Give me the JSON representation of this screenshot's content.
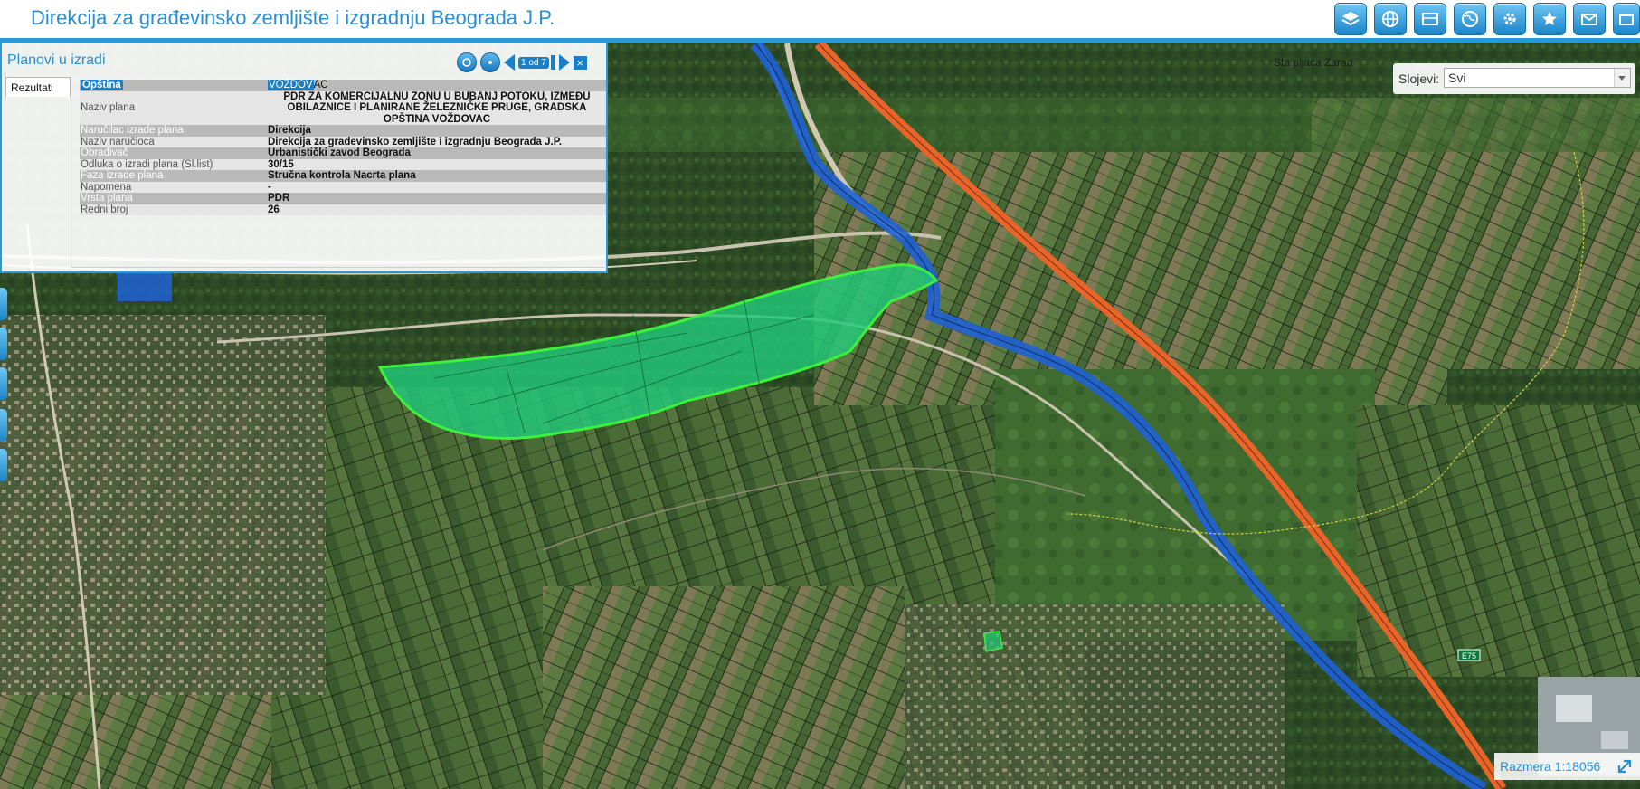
{
  "header": {
    "title": "Direkcija za građevinsko zemljište i izgradnju Beograda J.P.",
    "toolbar": [
      {
        "icon": "layers-icon"
      },
      {
        "icon": "globe-icon"
      },
      {
        "icon": "map-sheet-icon"
      },
      {
        "icon": "world-icon"
      },
      {
        "icon": "tools-icon"
      },
      {
        "icon": "star-icon"
      },
      {
        "icon": "mail-icon"
      },
      {
        "icon": "more-icon"
      }
    ]
  },
  "panel": {
    "title": "Planovi u izradi",
    "page_indicator": "1 od 7",
    "tab_label": "Rezultati",
    "rows": [
      {
        "key": "Opština",
        "value": "VOŽDOVAC",
        "value_highlight": "VOŽDOV",
        "value_rest": "AC"
      },
      {
        "key": "Naziv plana",
        "value": "PDR ZA KOMERCIJALNU ZONU U BUBANJ POTOKU, IZMEĐU OBILAZNICE I PLANIRANE ŽELEZNIČKE PRUGE, GRADSKA OPŠTINA VOŽDOVAC"
      },
      {
        "key": "Naručilac izrade plana",
        "value": "Direkcija"
      },
      {
        "key": "Naziv naručioca",
        "value": "Direkcija za građevinsko zemljište i izgradnju Beograda J.P."
      },
      {
        "key": "Obrađivač",
        "value": "Urbanistički zavod Beograda"
      },
      {
        "key": "Odluka o izradi plana (Sl.list)",
        "value": "30/15"
      },
      {
        "key": "Faza izrade plana",
        "value": "Stručna kontrola Nacrta plana"
      },
      {
        "key": "Napomena",
        "value": "-"
      },
      {
        "key": "Vrsta plana",
        "value": "PDR"
      },
      {
        "key": "Redni broj",
        "value": "26"
      }
    ]
  },
  "layers": {
    "label": "Slojevi:",
    "selected": "Svi"
  },
  "map": {
    "label": "Sta pijaca Zarad",
    "road_sign": "E75",
    "colors": {
      "plan_fill": "#22c97a",
      "plan_outline": "#3cf03c",
      "highway": "#e8652a",
      "corridor": "#1f62d4"
    }
  },
  "scale": {
    "text": "Razmera 1:18056"
  }
}
